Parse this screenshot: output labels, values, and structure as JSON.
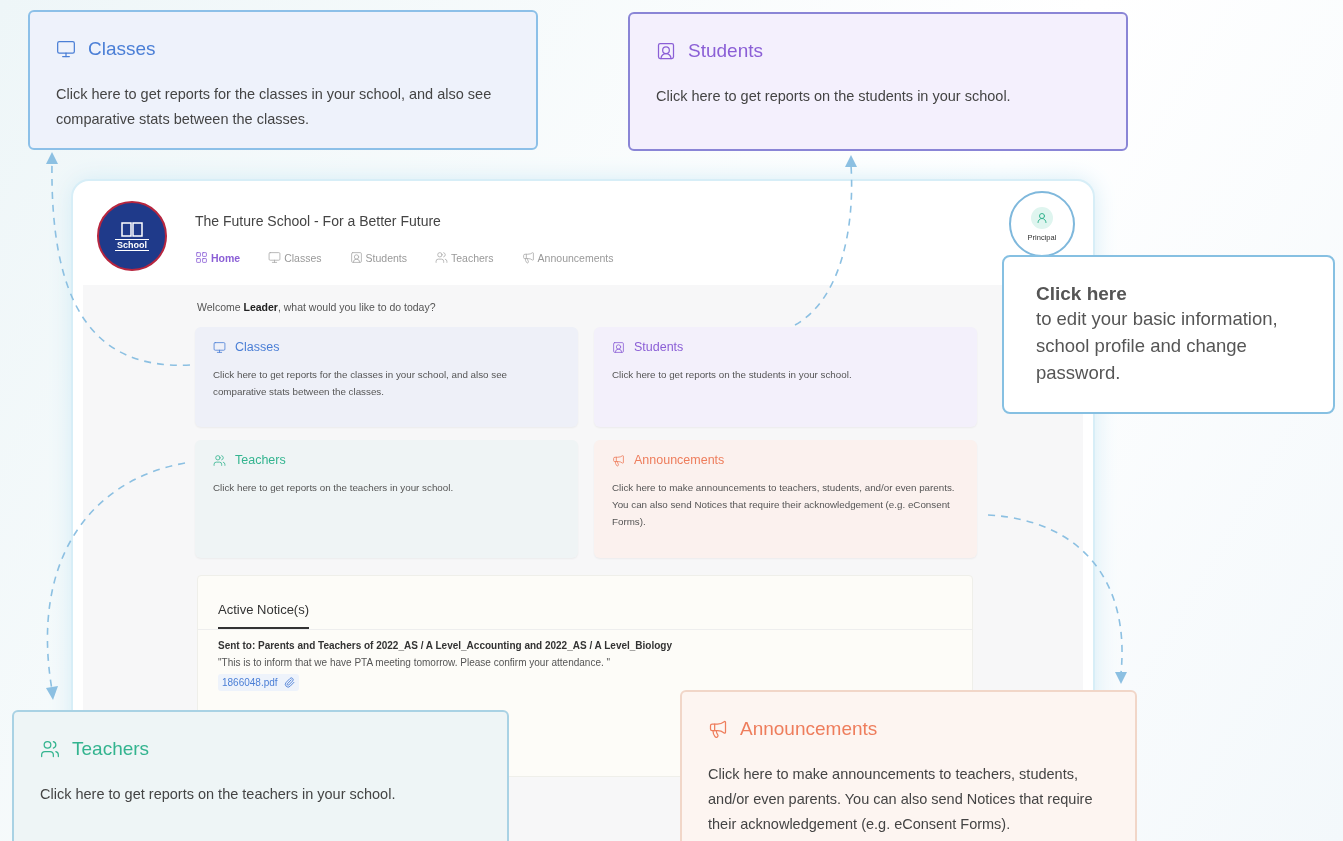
{
  "window": {
    "school_name": "The Future School - For a Better Future",
    "logo_text": "School",
    "nav": [
      {
        "kind": "home",
        "label": "Home",
        "selected": true
      },
      {
        "kind": "classes",
        "label": "Classes",
        "selected": false
      },
      {
        "kind": "students",
        "label": "Students",
        "selected": false
      },
      {
        "kind": "teachers",
        "label": "Teachers",
        "selected": false
      },
      {
        "kind": "announcements",
        "label": "Announcements",
        "selected": false
      }
    ],
    "profile": {
      "label": "Principal"
    },
    "welcome": "Welcome **Leader**, what would you like to do today?",
    "cards": [
      {
        "kind": "classes",
        "title": "Classes",
        "text": "Click here to get reports for the classes in your school, and also see comparative stats between the classes."
      },
      {
        "kind": "students",
        "title": "Students",
        "text": "Click here to get reports on the students in your school."
      },
      {
        "kind": "teachers",
        "title": "Teachers",
        "text": "Click here to get reports on the teachers in your school."
      },
      {
        "kind": "announcements",
        "title": "Announcements",
        "text": "Click here to make announcements to teachers, students, and/or even parents. You can also send Notices that require their acknowledgement (e.g. eConsent Forms)."
      }
    ],
    "notices": {
      "tab": "Active Notice(s)",
      "sent_to": "Sent to: Parents and Teachers of 2022_AS / A Level_Accounting and 2022_AS / A Level_Biology",
      "message": "\"This is to inform that we have PTA meeting tomorrow. Please confirm your attendance. \"",
      "attachment": "1866048.pdf"
    }
  },
  "callouts": [
    {
      "kind": "classes",
      "title": "Classes",
      "text": "Click here to get reports for the classes in your school, and also see comparative stats between the classes."
    },
    {
      "kind": "students",
      "title": "Students",
      "text": "Click here to get reports on the students in your school."
    },
    {
      "kind": "teachers",
      "title": "Teachers",
      "text": "Click here to get reports on the teachers in your school."
    },
    {
      "kind": "announcements",
      "title": "Announcements",
      "text": "Click here to make announcements to teachers, students, and/or even parents. You can also send Notices that require their acknowledgement (e.g. eConsent Forms)."
    }
  ],
  "profile_callout": {
    "title": "Click here",
    "text": "to edit your basic information, school profile and change password."
  }
}
